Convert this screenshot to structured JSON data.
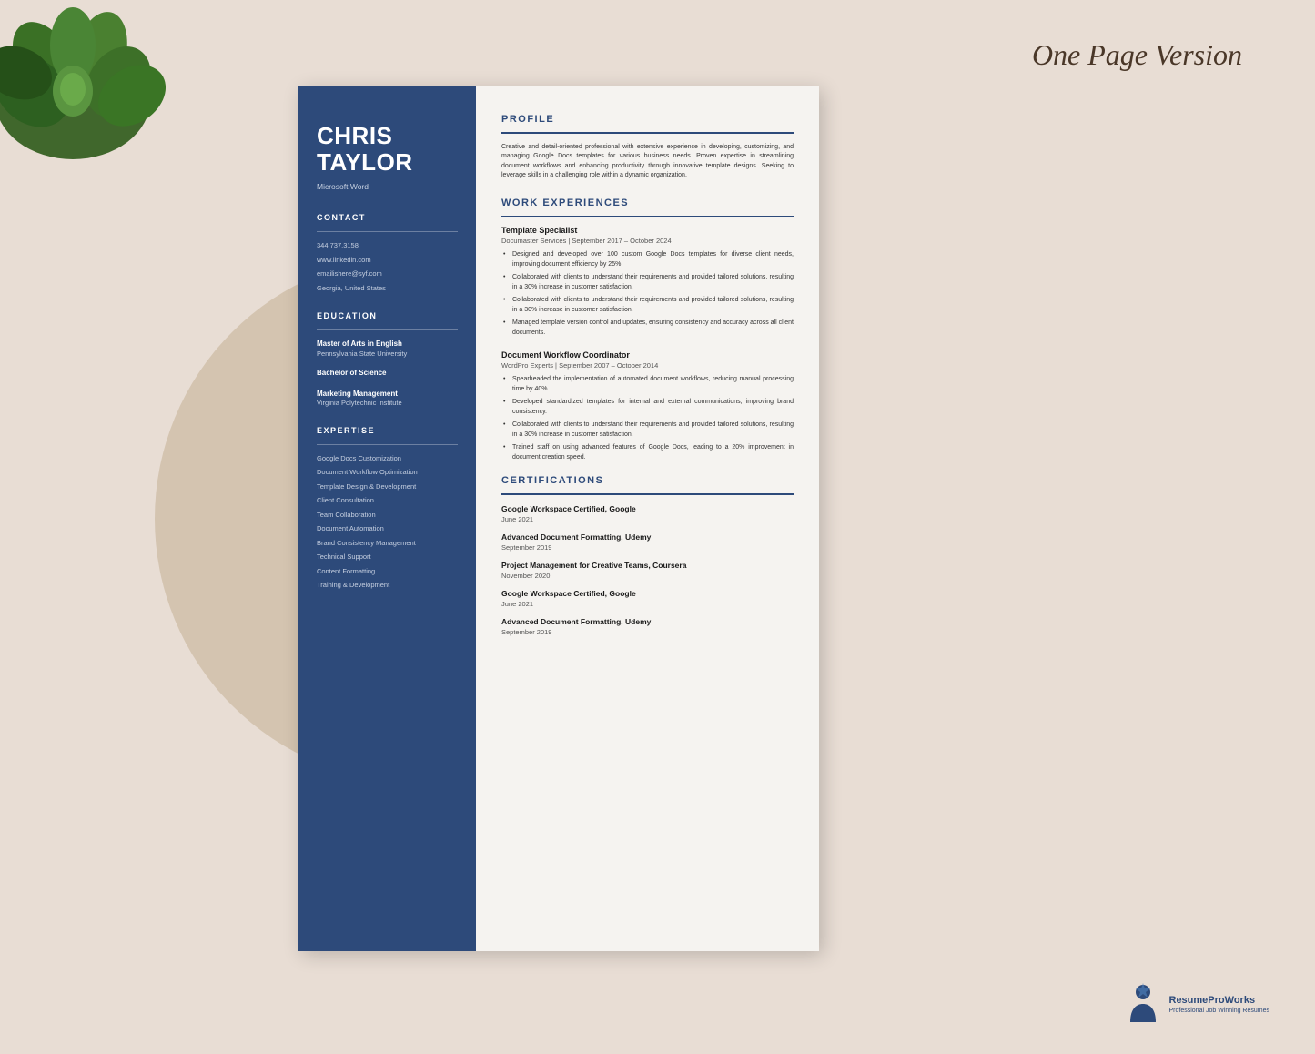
{
  "page": {
    "title": "One Page Version",
    "background_color": "#e8ddd4"
  },
  "sidebar": {
    "name_line1": "CHRIS",
    "name_line2": "TAYLOR",
    "subtitle": "Microsoft Word",
    "contact_section": "CONTACT",
    "contact_items": [
      "344.737.3158",
      "www.linkedin.com",
      "emailishere@syf.com",
      "Georgia, United States"
    ],
    "education_section": "EDUCATION",
    "education_items": [
      {
        "degree": "Master of Arts in English",
        "school": "Pennsylvania State University"
      },
      {
        "degree": "Bachelor of Science",
        "school": ""
      },
      {
        "degree": "Marketing Management",
        "school": "Virginia Polytechnic Institute"
      }
    ],
    "expertise_section": "EXPERTISE",
    "expertise_items": [
      "Google Docs Customization",
      "Document Workflow Optimization",
      "Template Design & Development",
      "Client Consultation",
      "Team Collaboration",
      "Document Automation",
      "Brand Consistency Management",
      "Technical Support",
      "Content Formatting",
      "Training & Development"
    ]
  },
  "main": {
    "profile_section": "PROFILE",
    "profile_text": "Creative and detail-oriented professional with extensive experience in developing, customizing, and managing Google Docs templates for various business needs. Proven expertise in streamlining document workflows and enhancing productivity through innovative template designs. Seeking to leverage skills in a challenging role within a dynamic organization.",
    "work_section": "WORK EXPERIENCES",
    "jobs": [
      {
        "title": "Template Specialist",
        "meta": "Documaster Services | September 2017 – October 2024",
        "bullets": [
          "Designed and developed over 100 custom Google Docs templates for diverse client needs, improving document efficiency by 25%.",
          "Collaborated with clients to understand their requirements and provided tailored solutions, resulting in a 30% increase in customer satisfaction.",
          "Collaborated with clients to understand their requirements and provided tailored solutions, resulting in a 30% increase in customer satisfaction.",
          "Managed template version control and updates, ensuring consistency and accuracy across all client documents."
        ]
      },
      {
        "title": "Document Workflow Coordinator",
        "meta": "WordPro Experts | September 2007 – October 2014",
        "bullets": [
          "Spearheaded the implementation of automated document workflows, reducing manual processing time by 40%.",
          "Developed standardized templates for internal and external communications, improving brand consistency.",
          "Collaborated with clients to understand their requirements and provided tailored solutions, resulting in a 30% increase in customer satisfaction.",
          "Trained staff on using advanced features of Google Docs, leading to a 20% improvement in document creation speed."
        ]
      }
    ],
    "certifications_section": "CERTIFICATIONS",
    "certifications": [
      {
        "name": "Google Workspace Certified, Google",
        "date": "June 2021"
      },
      {
        "name": "Advanced Document Formatting, Udemy",
        "date": "September 2019"
      },
      {
        "name": "Project Management for Creative Teams, Coursera",
        "date": "November 2020"
      },
      {
        "name": "Google Workspace Certified, Google",
        "date": "June 2021"
      },
      {
        "name": "Advanced Document Formatting, Udemy",
        "date": "September 2019"
      }
    ]
  },
  "logo": {
    "line1": "ResumePro",
    "line2": "Works",
    "subtext": "Professional Job Winning Resumes"
  }
}
